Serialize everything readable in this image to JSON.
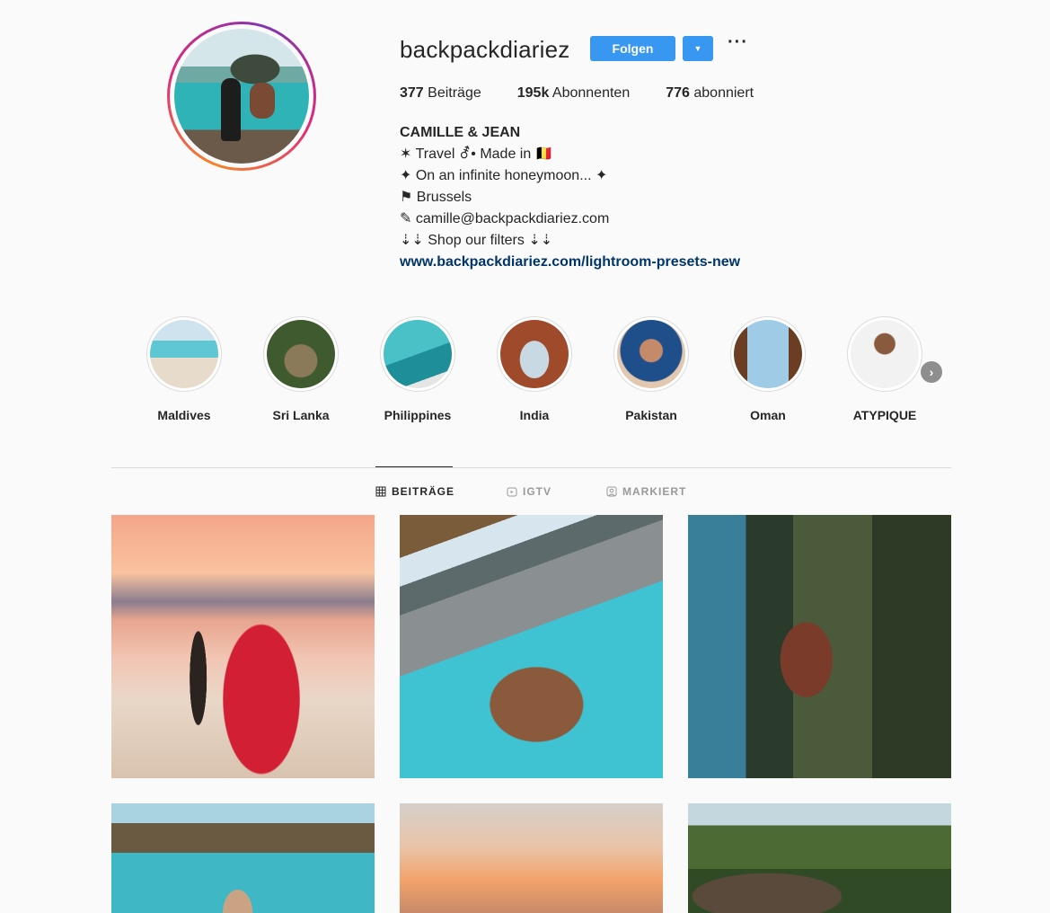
{
  "profile": {
    "username": "backpackdiariez",
    "follow_label": "Folgen",
    "dropdown_icon": "▼",
    "more_icon": "···"
  },
  "stats": {
    "posts_count": "377",
    "posts_label": "Beiträge",
    "followers_count": "195k",
    "followers_label": "Abonnenten",
    "following_count": "776",
    "following_label": "abonniert"
  },
  "bio": {
    "name": "CAMILLE & JEAN",
    "line1": "✶ Travel ⚦• Made in 🇧🇪",
    "line2": "✦ On an infinite honeymoon... ✦",
    "line3": "⚑ Brussels",
    "line4": "✎ camille@backpackdiariez.com",
    "line5": "⇣⇣ Shop our filters ⇣⇣",
    "link": "www.backpackdiariez.com/lightroom-presets-new"
  },
  "highlights": [
    {
      "label": "Maldives"
    },
    {
      "label": "Sri Lanka"
    },
    {
      "label": "Philippines"
    },
    {
      "label": "India"
    },
    {
      "label": "Pakistan"
    },
    {
      "label": "Oman"
    },
    {
      "label": "ATYPIQUE"
    }
  ],
  "highlights_next_icon": "›",
  "tabs": [
    {
      "label": "BEITRÄGE",
      "icon": "grid-icon",
      "active": true
    },
    {
      "label": "IGTV",
      "icon": "igtv-icon",
      "active": false
    },
    {
      "label": "MARKIERT",
      "icon": "tagged-icon",
      "active": false
    }
  ],
  "colors": {
    "accent": "#3897f0",
    "link": "#003569",
    "text": "#262626",
    "muted": "#999999",
    "background": "#fafafa"
  }
}
